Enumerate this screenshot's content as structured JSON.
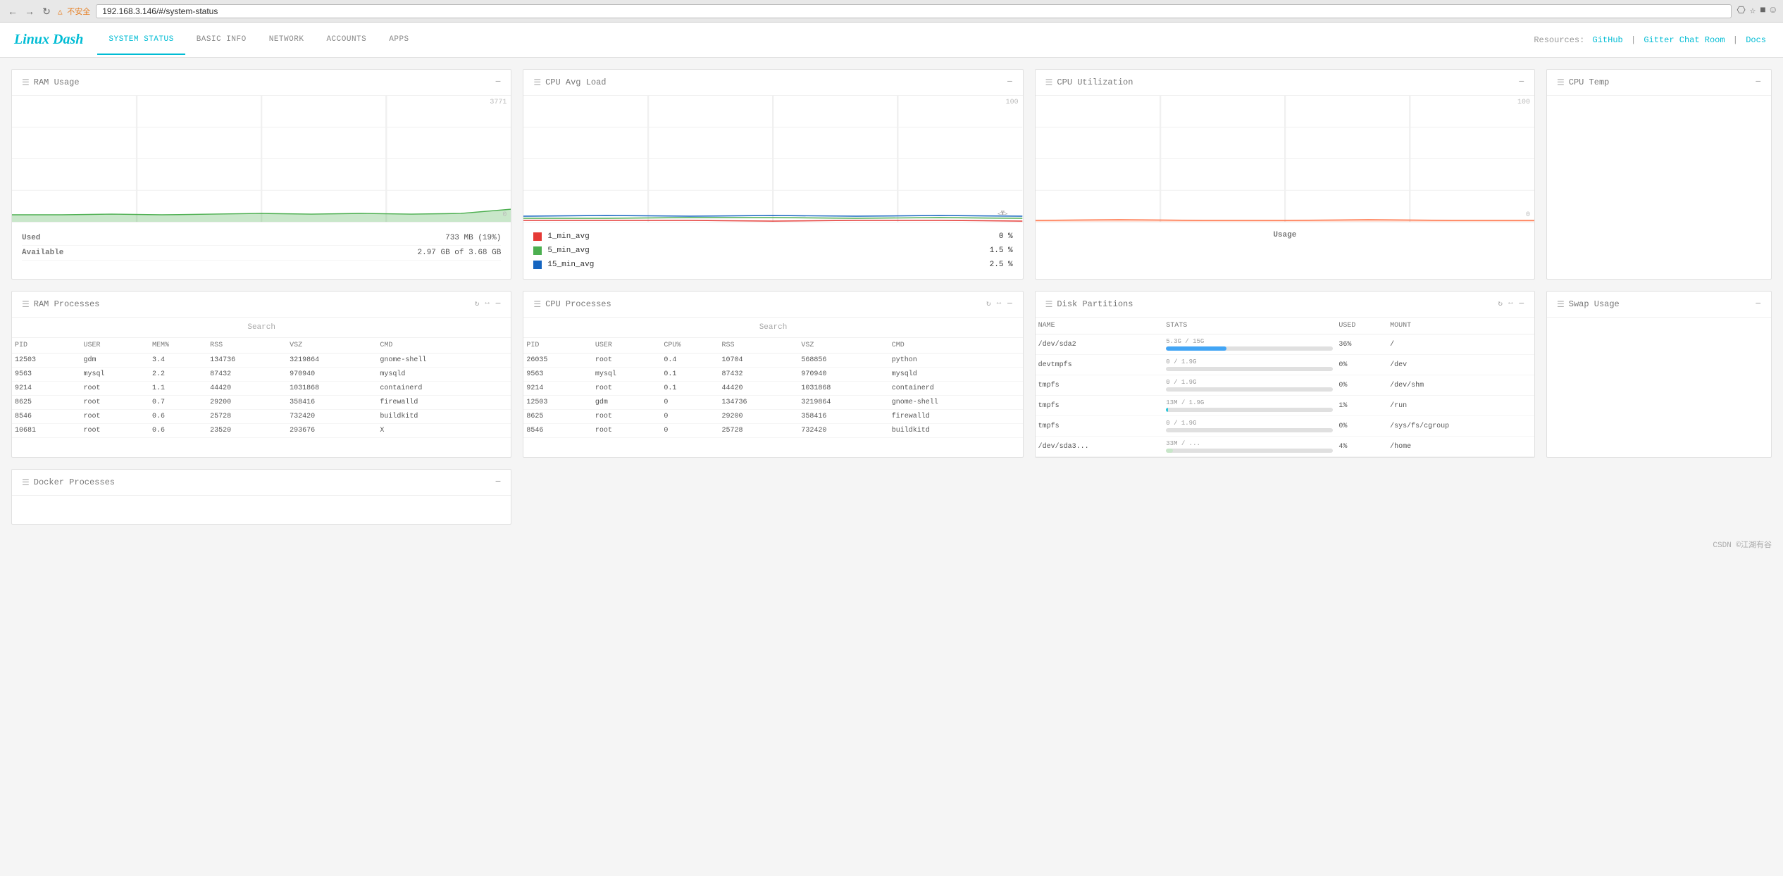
{
  "browser": {
    "url": "192.168.3.146/#/system-status",
    "warning": "不安全"
  },
  "app": {
    "logo": "Linux Dash",
    "nav": [
      {
        "label": "SYSTEM STATUS",
        "active": true
      },
      {
        "label": "BASIC INFO",
        "active": false
      },
      {
        "label": "NETWORK",
        "active": false
      },
      {
        "label": "ACCOUNTS",
        "active": false
      },
      {
        "label": "APPS",
        "active": false
      }
    ],
    "resources_label": "Resources:",
    "github_label": "GitHub",
    "gitter_label": "Gitter Chat Room",
    "docs_label": "Docs"
  },
  "ram_usage": {
    "title": "RAM Usage",
    "max_label": "3771",
    "min_label": "0",
    "used_label": "Used",
    "used_value": "733 MB (19%)",
    "available_label": "Available",
    "available_value": "2.97 GB of 3.68 GB"
  },
  "cpu_avg_load": {
    "title": "CPU Avg Load",
    "max_label": "100",
    "min_label": "",
    "legend": [
      {
        "color": "#e53935",
        "label": "1_min_avg",
        "value": "0 %"
      },
      {
        "color": "#4caf50",
        "label": "5_min_avg",
        "value": "1.5 %"
      },
      {
        "color": "#1565c0",
        "label": "15_min_avg",
        "value": "2.5 %"
      }
    ]
  },
  "cpu_utilization": {
    "title": "CPU Utilization",
    "max_label": "100",
    "min_label": "0",
    "usage_label": "Usage"
  },
  "cpu_temp": {
    "title": "CPU Temp"
  },
  "ram_processes": {
    "title": "RAM Processes",
    "search_placeholder": "Search",
    "columns": [
      "PID",
      "USER",
      "MEM%",
      "RSS",
      "VSZ",
      "CMD"
    ],
    "rows": [
      {
        "pid": "12503",
        "user": "gdm",
        "mem": "3.4",
        "rss": "134736",
        "vsz": "3219864",
        "cmd": "gnome-shell"
      },
      {
        "pid": "9563",
        "user": "mysql",
        "mem": "2.2",
        "rss": "87432",
        "vsz": "970940",
        "cmd": "mysqld"
      },
      {
        "pid": "9214",
        "user": "root",
        "mem": "1.1",
        "rss": "44420",
        "vsz": "1031868",
        "cmd": "containerd"
      },
      {
        "pid": "8625",
        "user": "root",
        "mem": "0.7",
        "rss": "29200",
        "vsz": "358416",
        "cmd": "firewalld"
      },
      {
        "pid": "8546",
        "user": "root",
        "mem": "0.6",
        "rss": "25728",
        "vsz": "732420",
        "cmd": "buildkitd"
      },
      {
        "pid": "10681",
        "user": "root",
        "mem": "0.6",
        "rss": "23520",
        "vsz": "293676",
        "cmd": "X"
      }
    ]
  },
  "cpu_processes": {
    "title": "CPU Processes",
    "search_placeholder": "Search",
    "columns": [
      "PID",
      "USER",
      "CPU%",
      "RSS",
      "VSZ",
      "CMD"
    ],
    "rows": [
      {
        "pid": "26035",
        "user": "root",
        "cpu": "0.4",
        "rss": "10704",
        "vsz": "568856",
        "cmd": "python"
      },
      {
        "pid": "9563",
        "user": "mysql",
        "cpu": "0.1",
        "rss": "87432",
        "vsz": "970940",
        "cmd": "mysqld"
      },
      {
        "pid": "9214",
        "user": "root",
        "cpu": "0.1",
        "rss": "44420",
        "vsz": "1031868",
        "cmd": "containerd"
      },
      {
        "pid": "12503",
        "user": "gdm",
        "cpu": "0",
        "rss": "134736",
        "vsz": "3219864",
        "cmd": "gnome-shell"
      },
      {
        "pid": "8625",
        "user": "root",
        "cpu": "0",
        "rss": "29200",
        "vsz": "358416",
        "cmd": "firewalld"
      },
      {
        "pid": "8546",
        "user": "root",
        "cpu": "0",
        "rss": "25728",
        "vsz": "732420",
        "cmd": "buildkitd"
      }
    ]
  },
  "disk_partitions": {
    "title": "Disk Partitions",
    "columns": [
      "NAME",
      "STATS",
      "USED",
      "MOUNT"
    ],
    "rows": [
      {
        "name": "/dev/sda2",
        "stats": "5.3G / 15G",
        "used_pct": 36,
        "used_label": "36%",
        "mount": "/",
        "color": "#42a5f5"
      },
      {
        "name": "devtmpfs",
        "stats": "0 / 1.9G",
        "used_pct": 0,
        "used_label": "0%",
        "mount": "/dev",
        "color": "#c8e6c9"
      },
      {
        "name": "tmpfs",
        "stats": "0 / 1.9G",
        "used_pct": 0,
        "used_label": "0%",
        "mount": "/dev/shm",
        "color": "#c8e6c9"
      },
      {
        "name": "tmpfs",
        "stats": "13M / 1.9G",
        "used_pct": 1,
        "used_label": "1%",
        "mount": "/run",
        "color": "#26c6da"
      },
      {
        "name": "tmpfs",
        "stats": "0 / 1.9G",
        "used_pct": 0,
        "used_label": "0%",
        "mount": "/sys/fs/cgroup",
        "color": "#c8e6c9"
      },
      {
        "name": "/dev/sda3...",
        "stats": "33M / ...",
        "used_pct": 4,
        "used_label": "4%",
        "mount": "/home",
        "color": "#c8e6c9"
      }
    ]
  },
  "swap_usage": {
    "title": "Swap Usage"
  },
  "docker_processes": {
    "title": "Docker Processes"
  },
  "footer": {
    "text": "CSDN ©江湖有谷"
  }
}
